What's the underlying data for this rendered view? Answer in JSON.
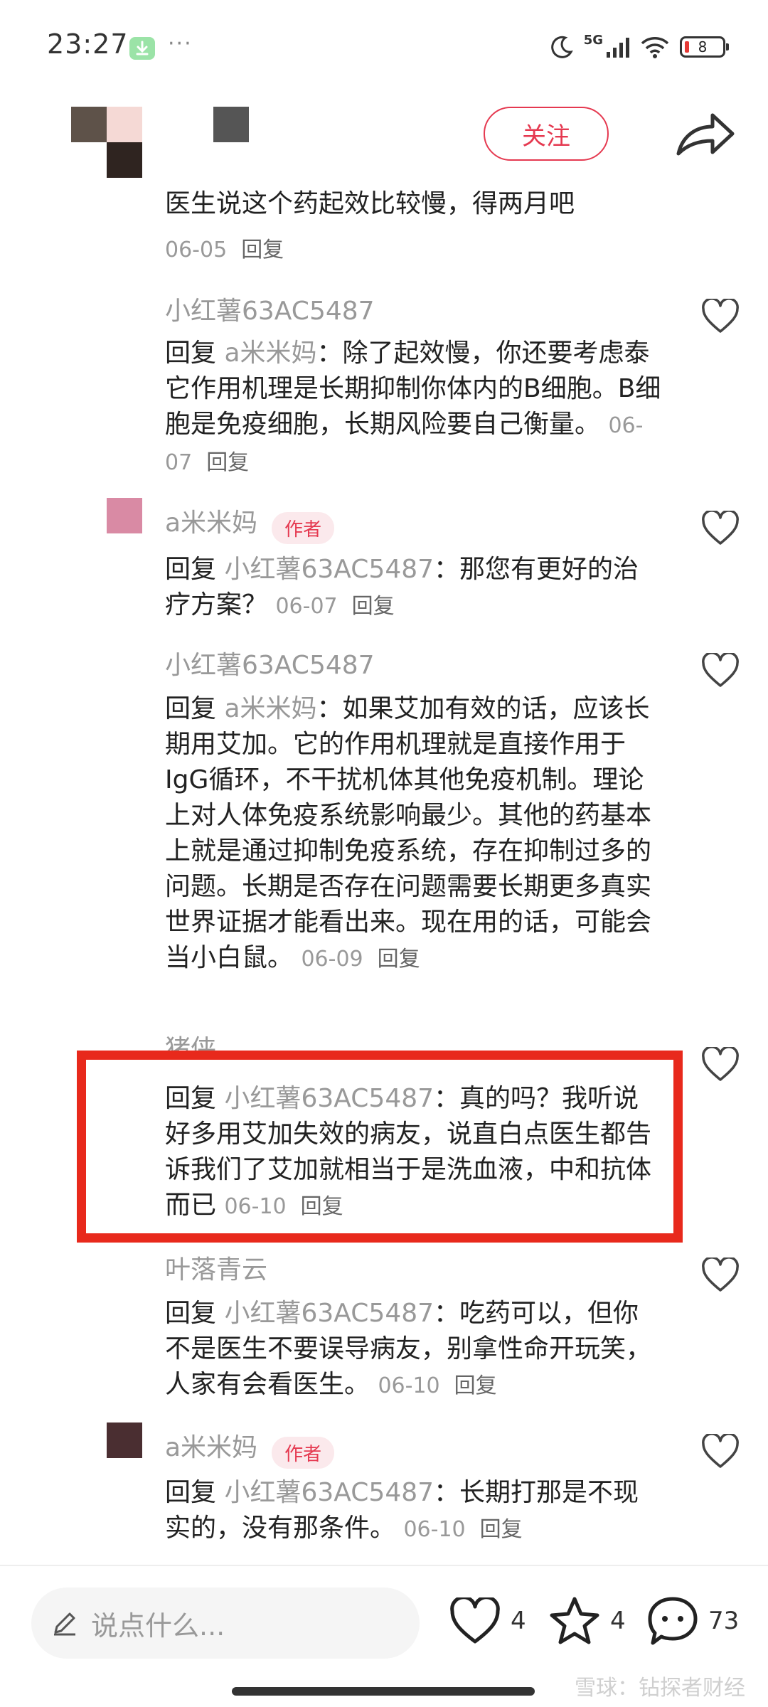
{
  "status_bar": {
    "time": "23:27",
    "more": "···",
    "network": "5G",
    "battery": "8"
  },
  "header": {
    "follow_label": "关注"
  },
  "comments": [
    {
      "text": "医生说这个药起效比较慢，得两月吧",
      "date": "06-05",
      "reply": "回复"
    },
    {
      "username": "小红薯63AC5487",
      "reply_prefix": "回复",
      "reply_to": "a米米妈",
      "text": "：除了起效慢，你还要考虑泰它作用机理是长期抑制你体内的B细胞。B细胞是免疫细胞，长期风险要自己衡量。",
      "date": "06-07",
      "reply": "回复"
    },
    {
      "username": "a米米妈",
      "badge": "作者",
      "reply_prefix": "回复",
      "reply_to": "小红薯63AC5487",
      "text": "：那您有更好的治疗方案？",
      "date": "06-07",
      "reply": "回复"
    },
    {
      "username": "小红薯63AC5487",
      "reply_prefix": "回复",
      "reply_to": "a米米妈",
      "text": "：如果艾加有效的话，应该长期用艾加。它的作用机理就是直接作用于IgG循环，不干扰机体其他免疫机制。理论上对人体免疫系统影响最少。其他的药基本上就是通过抑制免疫系统，存在抑制过多的问题。长期是否存在问题需要长期更多真实世界证据才能看出来。现在用的话，可能会当小白鼠。",
      "date": "06-09",
      "reply": "回复"
    },
    {
      "username": "猪侠",
      "reply_prefix": "回复",
      "reply_to": "小红薯63AC5487",
      "text": "：真的吗？我听说好多用艾加失效的病友，说直白点医生都告诉我们了艾加就相当于是洗血液，中和抗体而已",
      "date": "06-10",
      "reply": "回复"
    },
    {
      "username": "叶落青云",
      "reply_prefix": "回复",
      "reply_to": "小红薯63AC5487",
      "text": "：吃药可以，但你不是医生不要误导病友，别拿性命开玩笑，人家有会看医生。",
      "date": "06-10",
      "reply": "回复"
    },
    {
      "username": "a米米妈",
      "badge": "作者",
      "reply_prefix": "回复",
      "reply_to": "小红薯63AC5487",
      "text": "：长期打那是不现实的，没有那条件。",
      "date": "06-10",
      "reply": "回复"
    }
  ],
  "bottom_bar": {
    "input_placeholder": "说点什么...",
    "likes": "4",
    "collects": "4",
    "comments": "73"
  },
  "watermark": "雪球：钻探者财经",
  "colors": {
    "accent": "#e53950",
    "highlight_box": "#e8291c"
  }
}
